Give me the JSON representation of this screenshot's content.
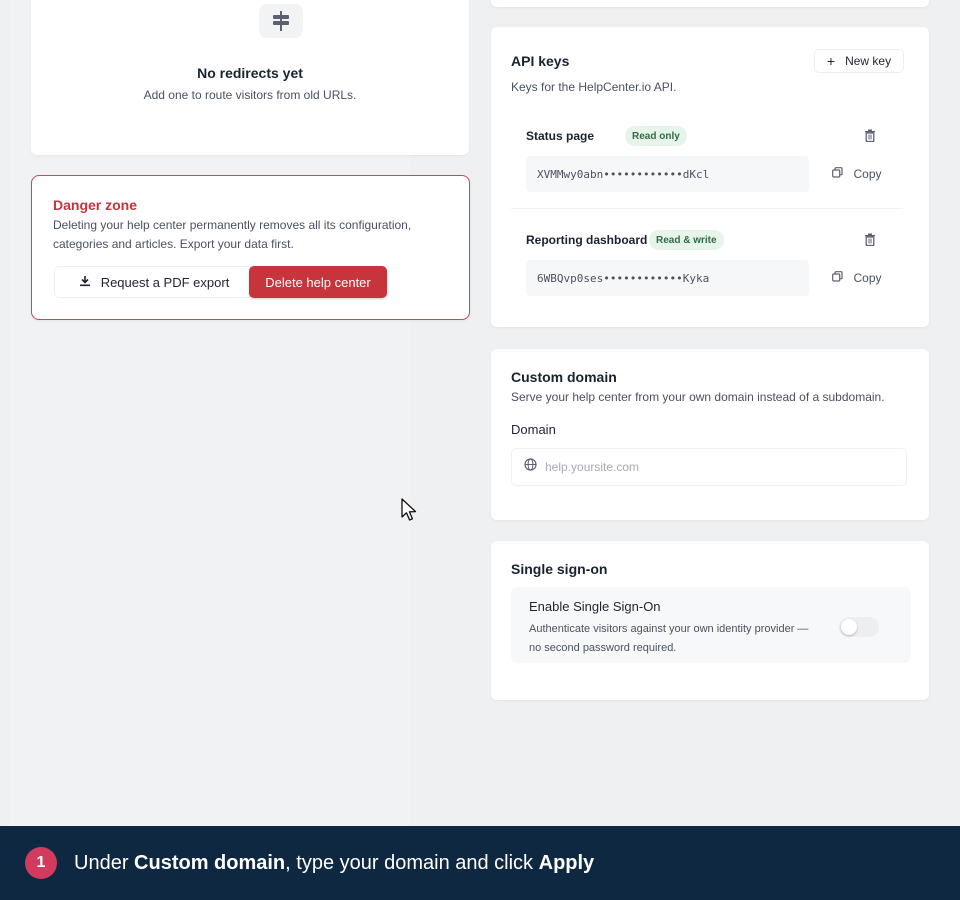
{
  "redirects": {
    "empty_title": "No redirects yet",
    "empty_subtitle": "Add one to route visitors from old URLs.",
    "icon": "signpost-icon"
  },
  "danger_zone": {
    "title": "Danger zone",
    "description": "Deleting your help center permanently removes all its configuration, categories and articles. Export your data first.",
    "export_label": "Request a PDF export",
    "delete_label": "Delete help center",
    "accent": "#c7323c"
  },
  "api_keys": {
    "title": "API keys",
    "subtitle": "Keys for the HelpCenter.io API.",
    "new_key_label": "New key",
    "keys": [
      {
        "name": "Status page",
        "badge": "Read only",
        "value": "XVMMwy0abn••••••••••••dKcl",
        "copy_label": "Copy"
      },
      {
        "name": "Reporting dashboard",
        "badge": "Read & write",
        "value": "6WBQvp0ses••••••••••••Kyka",
        "copy_label": "Copy"
      }
    ]
  },
  "custom_domain": {
    "title": "Custom domain",
    "subtitle": "Serve your help center from your own domain instead of a subdomain.",
    "field_label": "Domain",
    "placeholder": "help.yoursite.com",
    "value": ""
  },
  "sso": {
    "title": "Single sign-on",
    "toggle_label": "Enable Single Sign-On",
    "toggle_desc": "Authenticate visitors against your own identity provider — no second password required.",
    "enabled": false
  },
  "banner": {
    "step": "1",
    "text_1": "Under ",
    "bold_1": "Custom domain",
    "text_2": ", type your domain and click ",
    "bold_2": "Apply",
    "background": "#0e2842",
    "badge_color": "#d33b5e"
  }
}
